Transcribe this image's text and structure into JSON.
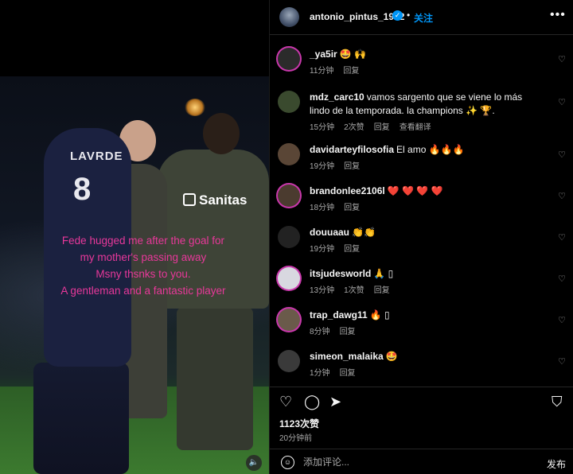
{
  "post": {
    "username": "antonio_pintus_1962",
    "follow_label": "关注",
    "dot": "•",
    "more": "•••",
    "likes": "1123次赞",
    "time_ago": "20分钟前"
  },
  "media": {
    "jersey_name": "LAVRDE",
    "jersey_number": "8",
    "sponsor": "Sanitas",
    "overlay_text": "Fede hugged me after the goal for\nmy mother's passing away\nMsny thsnks to you.\nA gentleman and a fantastic player",
    "mute_icon": "🔈"
  },
  "comments": [
    {
      "user": "_ya5ir",
      "text": "🤩 🙌",
      "time": "11分钟",
      "reply": "回复",
      "likes": "",
      "translate": "",
      "avatar_color": "#2b2b2b"
    },
    {
      "user": "mdz_carc10",
      "text": "vamos sargento que se viene lo más lindo de la temporada. la champions ✨ 🏆.",
      "time": "15分钟",
      "reply": "回复",
      "likes": "2次赞",
      "translate": "查看翻译",
      "avatar_color": "#3a4a2e"
    },
    {
      "user": "davidarteyfilosofia",
      "text": "El amo 🔥🔥🔥",
      "time": "19分钟",
      "reply": "回复",
      "likes": "",
      "translate": "",
      "avatar_color": "#5a4636"
    },
    {
      "user": "brandonlee2106l",
      "text": "❤️ ❤️ ❤️ ❤️",
      "time": "18分钟",
      "reply": "回复",
      "likes": "",
      "translate": "",
      "avatar_color": "#4b3b2f"
    },
    {
      "user": "douuaau",
      "text": "👏👏",
      "time": "19分钟",
      "reply": "回复",
      "likes": "",
      "translate": "",
      "avatar_color": "#222222"
    },
    {
      "user": "itsjudesworld",
      "text": "🙏 ▯",
      "time": "13分钟",
      "reply": "回复",
      "likes": "1次赞",
      "translate": "",
      "avatar_color": "#d8d8e0"
    },
    {
      "user": "trap_dawg11",
      "text": "🔥 ▯",
      "time": "8分钟",
      "reply": "回复",
      "likes": "",
      "translate": "",
      "avatar_color": "#6a5a4a"
    },
    {
      "user": "simeon_malaika",
      "text": "🤩",
      "time": "1分钟",
      "reply": "回复",
      "likes": "",
      "translate": "",
      "avatar_color": "#3a3a3a"
    }
  ],
  "add_comment": {
    "placeholder": "添加评论...",
    "post_label": "发布"
  },
  "icons": {
    "heart": "♡",
    "comment": "◯",
    "share": "➤",
    "bookmark": "⛉",
    "emoji": "☺",
    "like_small": "♡",
    "verified": "✓"
  }
}
